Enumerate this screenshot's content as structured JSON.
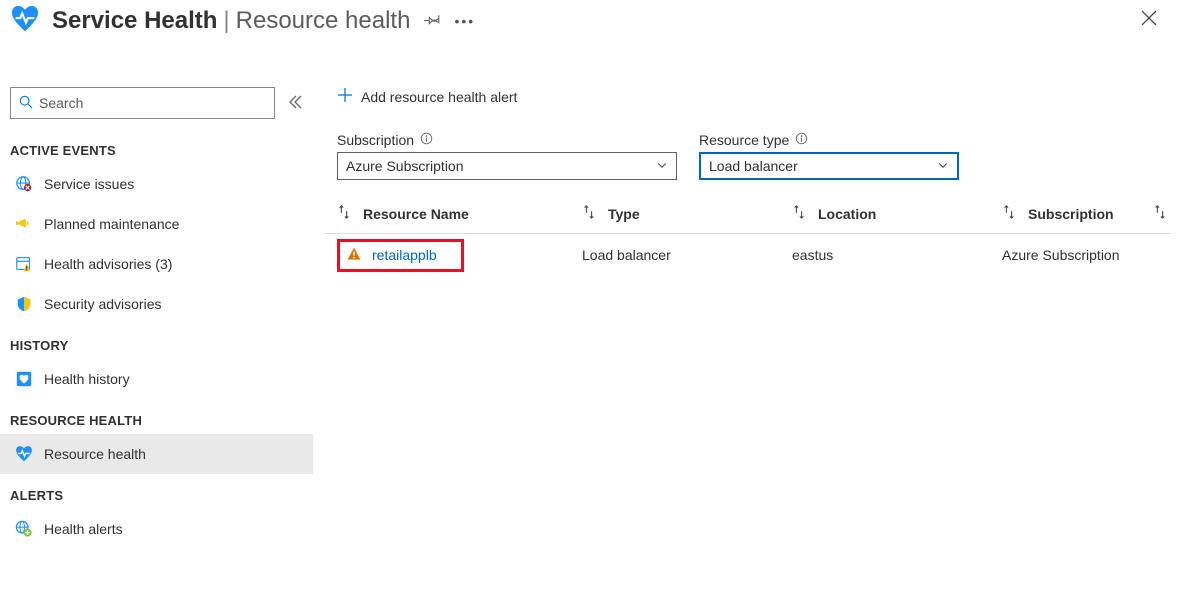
{
  "header": {
    "title": "Service Health",
    "subtitle": "Resource health"
  },
  "search": {
    "placeholder": "Search"
  },
  "nav": {
    "sections": [
      {
        "label": "ACTIVE EVENTS",
        "items": [
          {
            "icon": "globe-alert",
            "label": "Service issues"
          },
          {
            "icon": "megaphone",
            "label": "Planned maintenance"
          },
          {
            "icon": "calendar-warn",
            "label": "Health advisories (3)"
          },
          {
            "icon": "shield",
            "label": "Security advisories"
          }
        ]
      },
      {
        "label": "HISTORY",
        "items": [
          {
            "icon": "heart-box",
            "label": "Health history"
          }
        ]
      },
      {
        "label": "RESOURCE HEALTH",
        "items": [
          {
            "icon": "heart-pulse",
            "label": "Resource health",
            "active": true
          }
        ]
      },
      {
        "label": "ALERTS",
        "items": [
          {
            "icon": "globe-plus",
            "label": "Health alerts"
          }
        ]
      }
    ]
  },
  "toolbar": {
    "add_alert_label": "Add resource health alert"
  },
  "filters": {
    "subscription": {
      "label": "Subscription",
      "value": "Azure Subscription"
    },
    "resource_type": {
      "label": "Resource type",
      "value": "Load balancer"
    }
  },
  "table": {
    "columns": {
      "name": "Resource Name",
      "type": "Type",
      "location": "Location",
      "subscription": "Subscription"
    },
    "rows": [
      {
        "name": "retailapplb",
        "type": "Load balancer",
        "location": "eastus",
        "subscription": "Azure Subscription",
        "status": "warning",
        "highlighted": true
      }
    ]
  }
}
